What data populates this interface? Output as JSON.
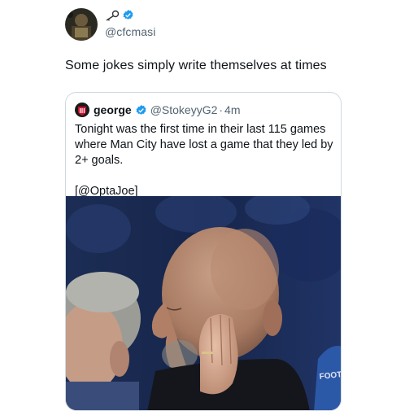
{
  "tweet": {
    "author_handle": "@cfcmasi",
    "text": "Some jokes simply write themselves at times"
  },
  "quote": {
    "name": "george",
    "handle": "@StokeyyG2",
    "separator": "·",
    "time": "4m",
    "body_line1": "Tonight was the first time in their last 115 games where Man City have lost a game that they led by 2+ goals.",
    "body_line2": "[@OptaJoe]",
    "image_caption_text": "FOOTBALL MANAGER"
  },
  "icons": {
    "profile_badge": "key-icon",
    "verified": "verified-badge-icon"
  },
  "colors": {
    "verified": "#1d9bf0",
    "handle": "#536471",
    "border": "#cfd9de"
  }
}
